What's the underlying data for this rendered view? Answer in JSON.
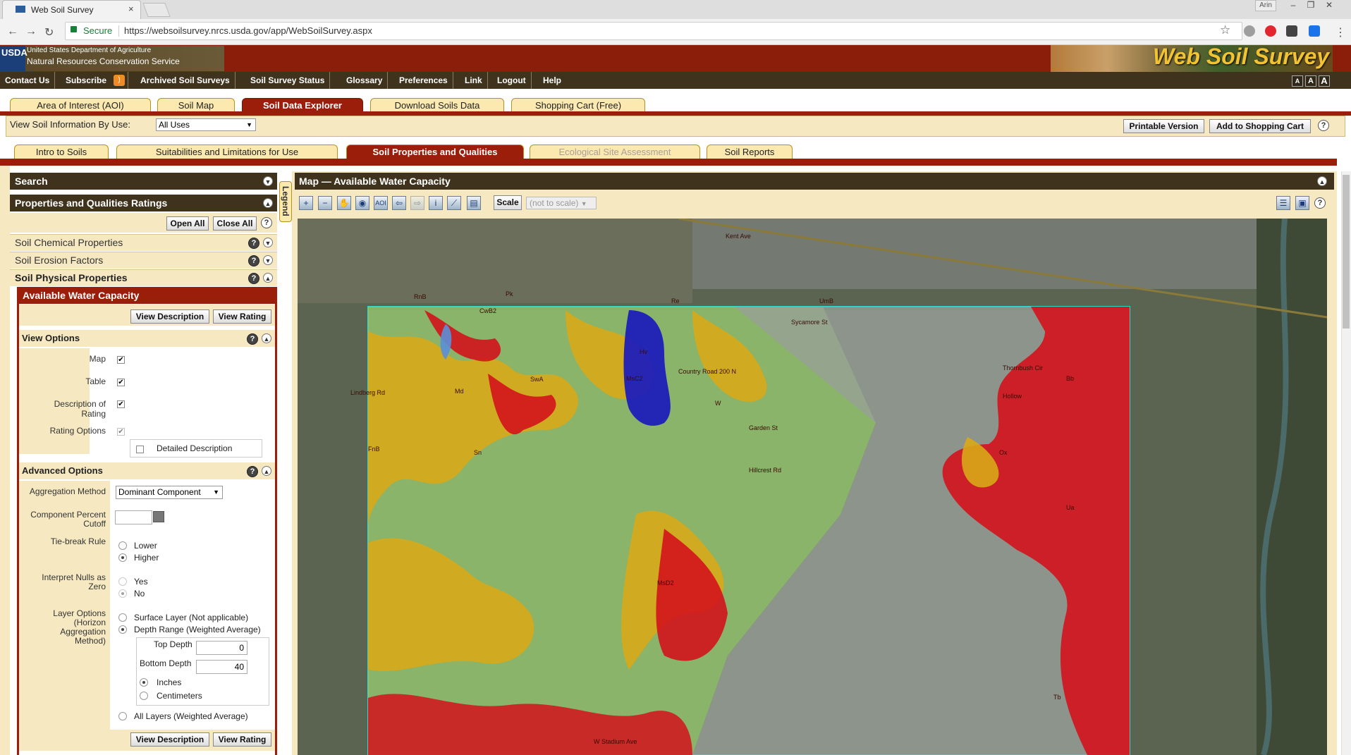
{
  "browser": {
    "tab_title": "Web Soil Survey",
    "tab_close": "×",
    "secure_label": "Secure",
    "url": "https://websoilsurvey.nrcs.usda.gov/app/WebSoilSurvey.aspx",
    "user_label": "Arin",
    "back": "←",
    "forward": "→",
    "reload": "↻",
    "star": "☆",
    "menu": "⋮",
    "minimize": "–",
    "restore": "❐",
    "close": "✕"
  },
  "header": {
    "usda_mark": "USDA",
    "dept": "United States Department of Agriculture",
    "agency": "Natural Resources Conservation Service",
    "app_title": "Web Soil Survey"
  },
  "topnav": {
    "items": [
      "Contact Us",
      "Subscribe",
      "Archived Soil Surveys",
      "Soil Survey Status",
      "Glossary",
      "Preferences",
      "Link",
      "Logout",
      "Help"
    ],
    "font_sizes": [
      "A",
      "A",
      "A"
    ]
  },
  "main_tabs": [
    "Area of Interest (AOI)",
    "Soil Map",
    "Soil Data Explorer",
    "Download Soils Data",
    "Shopping Cart (Free)"
  ],
  "view_bar": {
    "label": "View Soil Information By Use:",
    "use_value": "All Uses",
    "printable": "Printable Version",
    "add_cart": "Add to Shopping Cart",
    "help": "?"
  },
  "sub_tabs": [
    "Intro to Soils",
    "Suitabilities and Limitations for Use",
    "Soil Properties and Qualities",
    "Ecological Site Assessment",
    "Soil Reports"
  ],
  "left": {
    "search": "Search",
    "ratings": "Properties and Qualities Ratings",
    "open_all": "Open All",
    "close_all": "Close All",
    "sections": [
      "Soil Chemical Properties",
      "Soil Erosion Factors",
      "Soil Physical Properties"
    ],
    "awc_title": "Available Water Capacity",
    "view_description": "View Description",
    "view_rating": "View Rating",
    "view_options": "View Options",
    "opt_map": "Map",
    "opt_table": "Table",
    "opt_desc1": "Description of",
    "opt_desc2": "Rating",
    "opt_rating": "Rating Options",
    "detailed_description": "Detailed Description",
    "advanced_options": "Advanced Options",
    "agg_label": "Aggregation Method",
    "agg_value": "Dominant Component",
    "cutoff1": "Component Percent",
    "cutoff2": "Cutoff",
    "tiebreak": "Tie-break Rule",
    "lower": "Lower",
    "higher": "Higher",
    "nulls1": "Interpret Nulls as",
    "nulls2": "Zero",
    "yes": "Yes",
    "no": "No",
    "layer1": "Layer Options",
    "layer2": "(Horizon",
    "layer3": "Aggregation",
    "layer4": "Method)",
    "surface": "Surface Layer (Not applicable)",
    "depth_range": "Depth Range (Weighted Average)",
    "top_depth": "Top Depth",
    "top_depth_value": "0",
    "bottom_depth": "Bottom Depth",
    "bottom_depth_value": "40",
    "inches": "Inches",
    "centimeters": "Centimeters",
    "all_layers": "All Layers (Weighted Average)"
  },
  "map": {
    "title": "Map — Available Water Capacity",
    "legend": "Legend",
    "scale": "Scale",
    "scale_value": "(not to scale)",
    "labels": [
      "Kent Ave",
      "Lindberg Rd",
      "Country Road 200 N",
      "Garden St",
      "Hillcrest Rd",
      "W Stadium Ave",
      "Sycamore St",
      "Hollow",
      "Thornbush Cir",
      "Hv",
      "UmB",
      "MsC2",
      "RnB",
      "CwB2",
      "SwA",
      "W",
      "Md",
      "Ox",
      "Ua",
      "Bb",
      "Pk",
      "Sn",
      "MsD2",
      "FnB",
      "Re",
      "Tb"
    ],
    "colors": {
      "red": "#d3121c",
      "yellow": "#d8a818",
      "green": "#8fbf6b",
      "blue": "#1d1db9",
      "light_blue": "#5b8fd8",
      "gray": "#9aa09a"
    }
  }
}
